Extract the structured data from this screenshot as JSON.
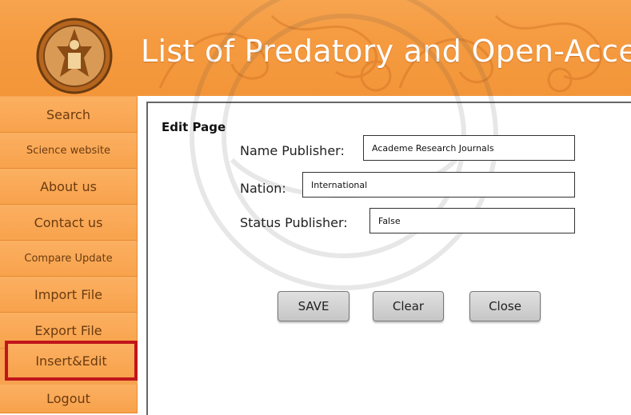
{
  "header": {
    "title": "List of Predatory and Open-Access",
    "logo_icon": "university-seal-icon"
  },
  "sidebar": {
    "items": [
      {
        "label": "Search"
      },
      {
        "label": "Science website"
      },
      {
        "label": "About us"
      },
      {
        "label": "Contact us"
      },
      {
        "label": "Compare Update"
      },
      {
        "label": "Import File"
      },
      {
        "label": "Export File"
      },
      {
        "label": "Insert&Edit",
        "active": true
      },
      {
        "label": "Logout"
      }
    ]
  },
  "form": {
    "title": "Edit Page",
    "name_publisher": {
      "label": "Name Publisher:",
      "value": "Academe Research Journals"
    },
    "nation": {
      "label": "Nation:",
      "value": "International"
    },
    "status_publisher": {
      "label": "Status Publisher:",
      "value": "False"
    },
    "buttons": {
      "save": "SAVE",
      "clear": "Clear",
      "close": "Close"
    }
  },
  "colors": {
    "header_orange": "#f59a3f",
    "active_border": "#c0161a",
    "nav_text": "#6b3b10"
  }
}
